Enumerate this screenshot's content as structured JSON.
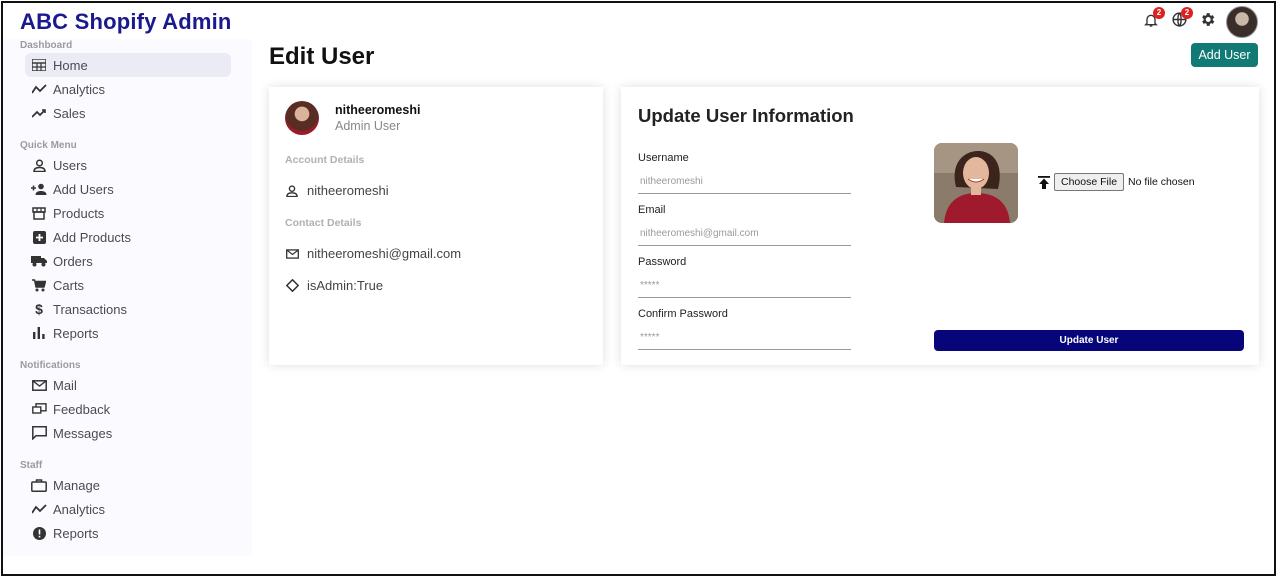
{
  "app": {
    "brand": "ABC Shopify Admin"
  },
  "topbar": {
    "notifications_badge": "2",
    "language_badge": "2",
    "icons": [
      "bell-icon",
      "globe-icon",
      "gear-icon",
      "avatar"
    ]
  },
  "sidebar": {
    "sections": [
      {
        "title": "Dashboard",
        "items": [
          {
            "label": "Home",
            "icon": "home-icon",
            "active": true
          },
          {
            "label": "Analytics",
            "icon": "timeline-icon"
          },
          {
            "label": "Sales",
            "icon": "trending-up-icon"
          }
        ]
      },
      {
        "title": "Quick Menu",
        "items": [
          {
            "label": "Users",
            "icon": "person-icon"
          },
          {
            "label": "Add Users",
            "icon": "person-add-icon"
          },
          {
            "label": "Products",
            "icon": "storefront-icon"
          },
          {
            "label": "Add Products",
            "icon": "add-box-icon"
          },
          {
            "label": "Orders",
            "icon": "truck-icon"
          },
          {
            "label": "Carts",
            "icon": "cart-icon"
          },
          {
            "label": "Transactions",
            "icon": "dollar-icon"
          },
          {
            "label": "Reports",
            "icon": "bar-chart-icon"
          }
        ]
      },
      {
        "title": "Notifications",
        "items": [
          {
            "label": "Mail",
            "icon": "mail-icon"
          },
          {
            "label": "Feedback",
            "icon": "feedback-icon"
          },
          {
            "label": "Messages",
            "icon": "chat-icon"
          }
        ]
      },
      {
        "title": "Staff",
        "items": [
          {
            "label": "Manage",
            "icon": "briefcase-icon"
          },
          {
            "label": "Analytics",
            "icon": "timeline-icon"
          },
          {
            "label": "Reports",
            "icon": "report-icon"
          }
        ]
      }
    ]
  },
  "main": {
    "title": "Edit User",
    "add_button": "Add User",
    "show": {
      "username": "nitheeromeshi",
      "user_title": "Admin User",
      "account_label": "Account Details",
      "account_username": "nitheeromeshi",
      "contact_label": "Contact Details",
      "email": "nitheeromeshi@gmail.com",
      "is_admin": "isAdmin:True"
    },
    "update": {
      "title": "Update User Information",
      "username_label": "Username",
      "username_placeholder": "nitheeromeshi",
      "email_label": "Email",
      "email_placeholder": "nitheeromeshi@gmail.com",
      "password_label": "Password",
      "password_value": "*****",
      "confirm_label": "Confirm Password",
      "confirm_value": "*****",
      "choose_file": "Choose File",
      "no_file": "No file chosen",
      "submit": "Update User"
    }
  },
  "colors": {
    "brand": "#1a1a8c",
    "add_button": "#117a74",
    "update_button": "#06067a",
    "badge": "#e02020"
  }
}
